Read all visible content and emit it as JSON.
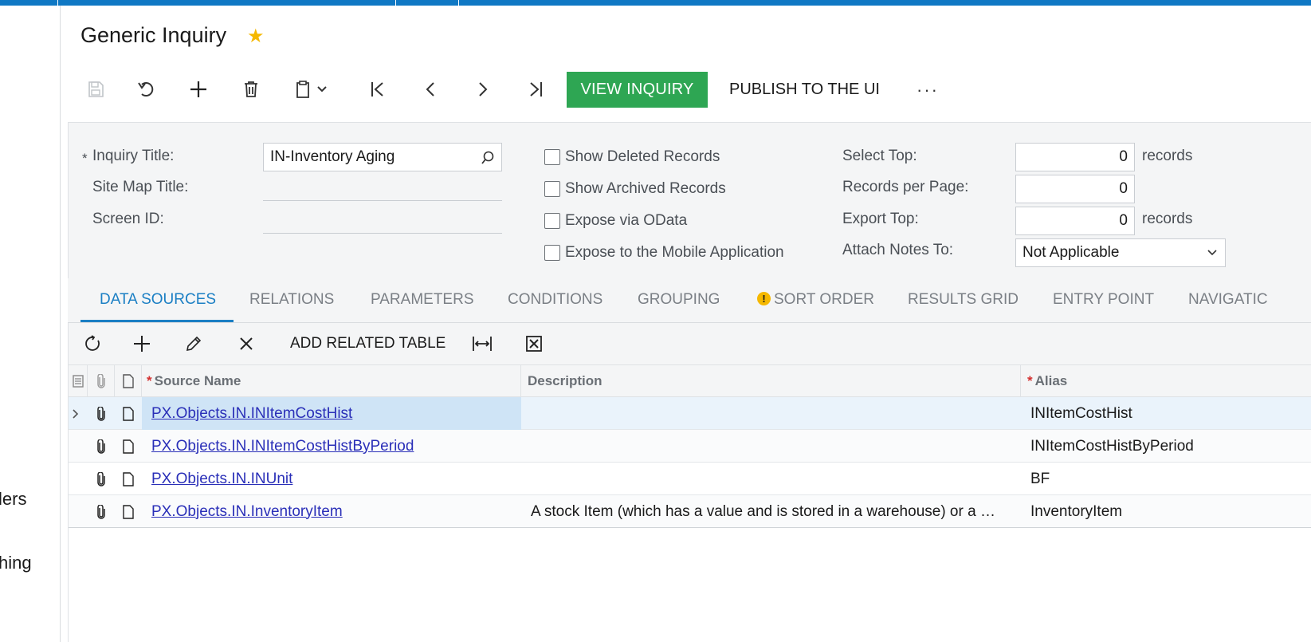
{
  "nav": {
    "fragments": [
      "lers",
      "hing"
    ]
  },
  "header": {
    "title": "Generic Inquiry"
  },
  "toolbar": {
    "view_inquiry": "VIEW INQUIRY",
    "publish": "PUBLISH TO THE UI",
    "more": "···"
  },
  "form": {
    "inquiry_title_label": "Inquiry Title:",
    "inquiry_title_value": "IN-Inventory Aging",
    "site_map_title_label": "Site Map Title:",
    "screen_id_label": "Screen ID:",
    "show_deleted": "Show Deleted Records",
    "show_archived": "Show Archived Records",
    "expose_odata": "Expose via OData",
    "expose_mobile": "Expose to the Mobile Application",
    "select_top_label": "Select Top:",
    "select_top_value": "0",
    "records_per_page_label": "Records per Page:",
    "records_per_page_value": "0",
    "export_top_label": "Export Top:",
    "export_top_value": "0",
    "records_suffix": "records",
    "attach_notes_label": "Attach Notes To:",
    "attach_notes_value": "Not Applicable"
  },
  "tabs": [
    "DATA SOURCES",
    "RELATIONS",
    "PARAMETERS",
    "CONDITIONS",
    "GROUPING",
    "SORT ORDER",
    "RESULTS GRID",
    "ENTRY POINT",
    "NAVIGATIC"
  ],
  "grid_toolbar": {
    "add_related": "ADD RELATED TABLE"
  },
  "grid": {
    "columns": [
      "Source Name",
      "Description",
      "Alias"
    ],
    "rows": [
      {
        "source": "PX.Objects.IN.INItemCostHist",
        "description": "",
        "alias": "INItemCostHist"
      },
      {
        "source": "PX.Objects.IN.INItemCostHistByPeriod",
        "description": "",
        "alias": "INItemCostHistByPeriod"
      },
      {
        "source": "PX.Objects.IN.INUnit",
        "description": "",
        "alias": "BF"
      },
      {
        "source": "PX.Objects.IN.InventoryItem",
        "description": "A stock Item (which has a value and is stored in a warehouse) or a …",
        "alias": "InventoryItem"
      }
    ]
  }
}
